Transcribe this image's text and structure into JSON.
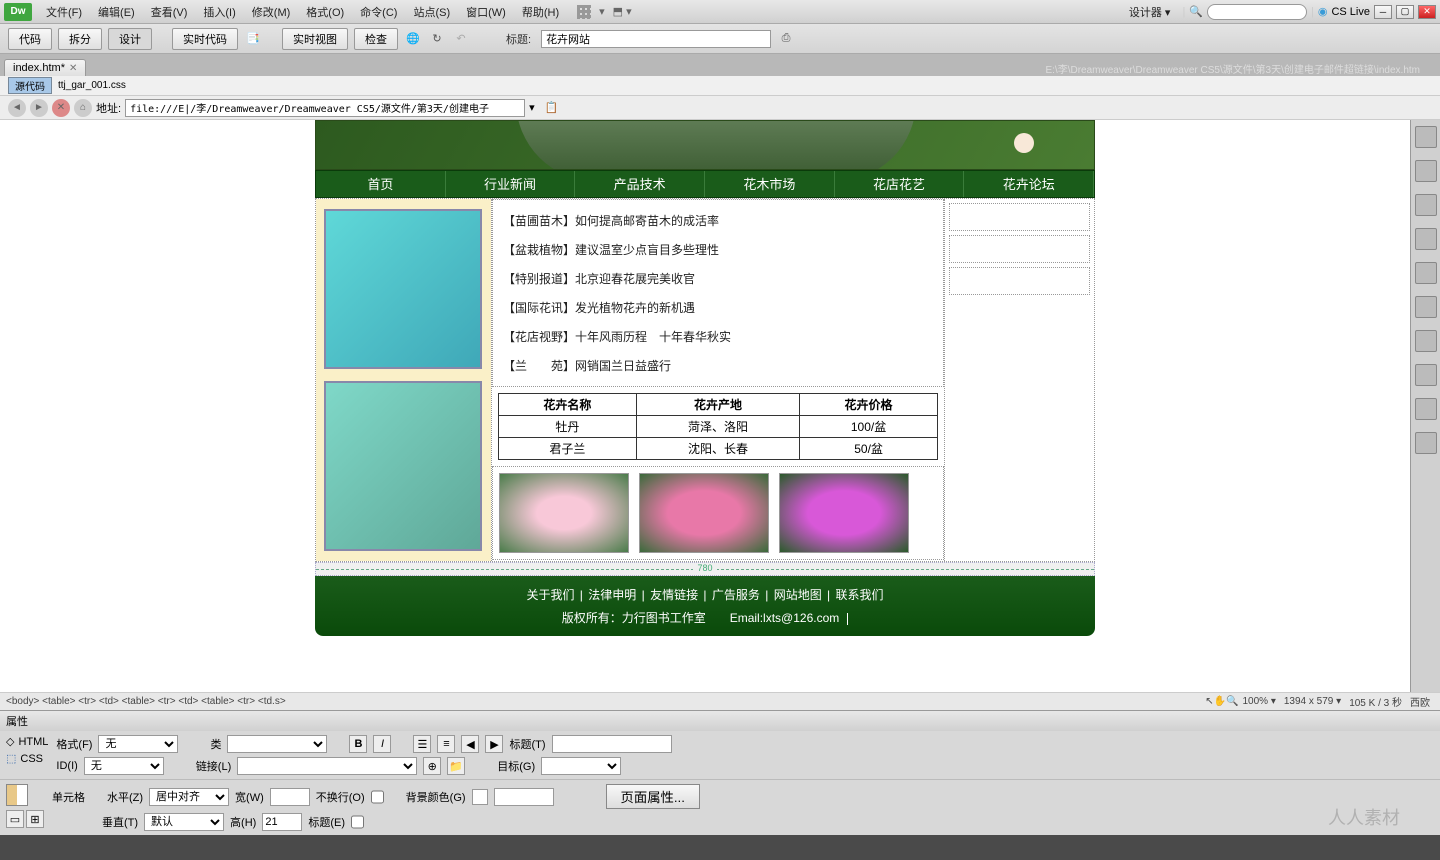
{
  "menu": {
    "logo": "Dw",
    "items": [
      "文件(F)",
      "编辑(E)",
      "查看(V)",
      "插入(I)",
      "修改(M)",
      "格式(O)",
      "命令(C)",
      "站点(S)",
      "窗口(W)",
      "帮助(H)"
    ],
    "designer": "设计器",
    "cslive": "CS Live"
  },
  "toolbar": {
    "code": "代码",
    "split": "拆分",
    "design": "设计",
    "livecode": "实时代码",
    "liveview": "实时视图",
    "inspect": "检查",
    "title_label": "标题:",
    "title_value": "花卉网站"
  },
  "tab": {
    "name": "index.htm*",
    "path": "E:\\李\\Dreamweaver\\Dreamweaver CS5\\源文件\\第3天\\创建电子邮件超链接\\index.htm"
  },
  "subtab": {
    "source": "源代码",
    "css": "ttj_gar_001.css"
  },
  "addr": {
    "label": "地址:",
    "value": "file:///E|/李/Dreamweaver/Dreamweaver CS5/源文件/第3天/创建电子"
  },
  "nav": [
    "首页",
    "行业新闻",
    "产品技术",
    "花木市场",
    "花店花艺",
    "花卉论坛"
  ],
  "news": [
    {
      "cat": "【苗圃苗木】",
      "title": "如何提高邮寄苗木的成活率"
    },
    {
      "cat": "【盆栽植物】",
      "title": "建议温室少点盲目多些理性"
    },
    {
      "cat": "【特别报道】",
      "title": "北京迎春花展完美收官"
    },
    {
      "cat": "【国际花讯】",
      "title": "发光植物花卉的新机遇"
    },
    {
      "cat": "【花店视野】",
      "title": "十年风雨历程　十年春华秋实"
    },
    {
      "cat": "【兰　　苑】",
      "title": "网销国兰日益盛行"
    }
  ],
  "table": {
    "headers": [
      "花卉名称",
      "花卉产地",
      "花卉价格"
    ],
    "rows": [
      [
        "牡丹",
        "菏泽、洛阳",
        "100/盆"
      ],
      [
        "君子兰",
        "沈阳、长春",
        "50/盆"
      ]
    ]
  },
  "ruler": "780",
  "footer": {
    "links": [
      "关于我们",
      "法律申明",
      "友情链接",
      "广告服务",
      "网站地图",
      "联系我们"
    ],
    "copy": "版权所有：力行图书工作室　　Email:lxts@126.com"
  },
  "breadcrumb": "<body> <table> <tr> <td> <table> <tr> <td> <table> <tr> <td.s>",
  "status": {
    "zoom": "100%",
    "dim": "1394 x 579",
    "size": "105 K / 3 秒",
    "enc": "西欧"
  },
  "prop": {
    "title": "属性",
    "html": "HTML",
    "css": "CSS",
    "format_l": "格式(F)",
    "format_v": "无",
    "id_l": "ID(I)",
    "id_v": "无",
    "class_l": "类",
    "class_v": "",
    "link_l": "链接(L)",
    "title_l": "标题(T)",
    "target_l": "目标(G)",
    "cell": "单元格",
    "horiz_l": "水平(Z)",
    "horiz_v": "居中对齐",
    "vert_l": "垂直(T)",
    "vert_v": "默认",
    "width_l": "宽(W)",
    "height_l": "高(H)",
    "height_v": "21",
    "nowrap_l": "不换行(O)",
    "header_l": "标题(E)",
    "bg_l": "背景颜色(G)",
    "pageprops": "页面属性..."
  },
  "watermark": "人人素材"
}
